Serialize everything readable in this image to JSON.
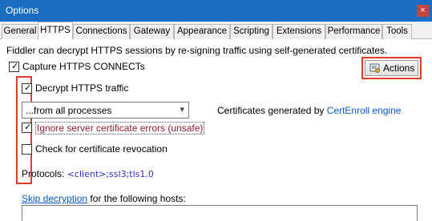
{
  "window": {
    "title": "Options",
    "close_glyph": "×"
  },
  "tabs": [
    {
      "label": "General",
      "active": false
    },
    {
      "label": "HTTPS",
      "active": true
    },
    {
      "label": "Connections",
      "active": false
    },
    {
      "label": "Gateway",
      "active": false
    },
    {
      "label": "Appearance",
      "active": false
    },
    {
      "label": "Scripting",
      "active": false
    },
    {
      "label": "Extensions",
      "active": false
    },
    {
      "label": "Performance",
      "active": false
    },
    {
      "label": "Tools",
      "active": false
    }
  ],
  "https": {
    "description": "Fiddler can decrypt HTTPS sessions by re-signing traffic using self-generated certificates.",
    "capture_label": "Capture HTTPS CONNECTs",
    "decrypt_label": "Decrypt HTTPS traffic",
    "process_filter_value": "...from all processes",
    "cert_text": "Certificates generated by",
    "cert_engine_link": "CertEnroll engine",
    "ignore_errors_label": "Ignore server certificate errors (unsafe)",
    "revocation_label": "Check for certificate revocation",
    "protocols_label": "Protocols:",
    "protocols_value": "<client>;ssl3;tls1.0",
    "skip_link": "Skip decryption",
    "skip_rest": "for the following hosts:",
    "actions_label": "Actions"
  },
  "state": {
    "capture_checked": true,
    "decrypt_checked": true,
    "ignore_errors_checked": true,
    "revocation_checked": false
  },
  "icons": {
    "check": "✓",
    "dropdown": "chevron-down-icon",
    "actions": "certificate-icon"
  },
  "colors": {
    "titlebar": "#1b6dc1",
    "highlight": "#e03c31",
    "link": "#0a58c8",
    "unsafe_text": "#9b1b2d"
  }
}
